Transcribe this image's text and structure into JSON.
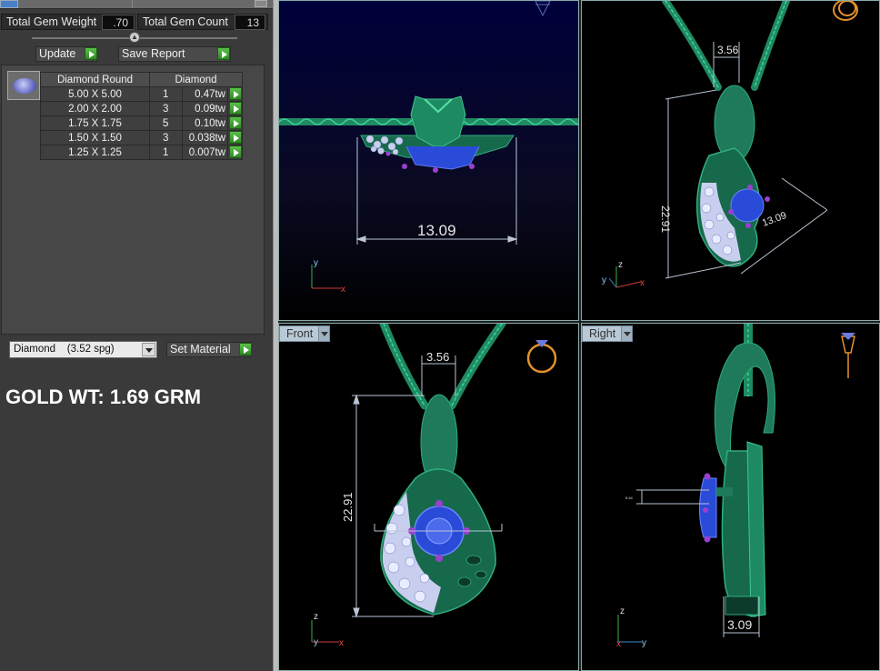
{
  "left_panel": {
    "total_gem_weight_label": "Total Gem Weight",
    "total_gem_weight_value": ".70",
    "total_gem_count_label": "Total Gem Count",
    "total_gem_count_value": "13",
    "update_label": "Update",
    "save_report_label": "Save Report",
    "table": {
      "headers": [
        "Diamond Round",
        "Diamond"
      ],
      "rows": [
        {
          "size": "5.00 X 5.00",
          "count": "1",
          "weight": "0.47tw"
        },
        {
          "size": "2.00 X 2.00",
          "count": "3",
          "weight": "0.09tw"
        },
        {
          "size": "1.75 X 1.75",
          "count": "5",
          "weight": "0.10tw"
        },
        {
          "size": "1.50 X 1.50",
          "count": "3",
          "weight": "0.038tw"
        },
        {
          "size": "1.25 X 1.25",
          "count": "1",
          "weight": "0.007tw"
        }
      ]
    },
    "material_select": "Diamond    (3.52 spg)",
    "set_material_label": "Set Material",
    "gold_weight_text": "GOLD WT: 1.69 GRM"
  },
  "viewports": {
    "top_left": {
      "dimension": "13.09",
      "axis_y": "y",
      "axis_x": "x"
    },
    "top_right": {
      "dim_width": "3.56",
      "dim_height": "22.91",
      "dim_depth": "13.09",
      "axis_z": "z",
      "axis_y": "y",
      "axis_x": "x"
    },
    "front": {
      "label": "Front",
      "dim_width": "3.56",
      "dim_height": "22.91",
      "axis_z": "z",
      "axis_y": "y",
      "axis_x": "x"
    },
    "right": {
      "label": "Right",
      "dim_width": "3.09",
      "dim_small": "5.44",
      "axis_z": "z",
      "axis_x": "x",
      "axis_y": "y"
    }
  },
  "colors": {
    "metal_green": "#1e7a5a",
    "metal_highlight": "#2fae7c",
    "stone_blue": "#2a4ad8",
    "pave_white": "#c8cfee",
    "prong_purple": "#9b3fd1",
    "dimension_line": "#b9c4d4",
    "ring_orange": "#e5912a"
  }
}
